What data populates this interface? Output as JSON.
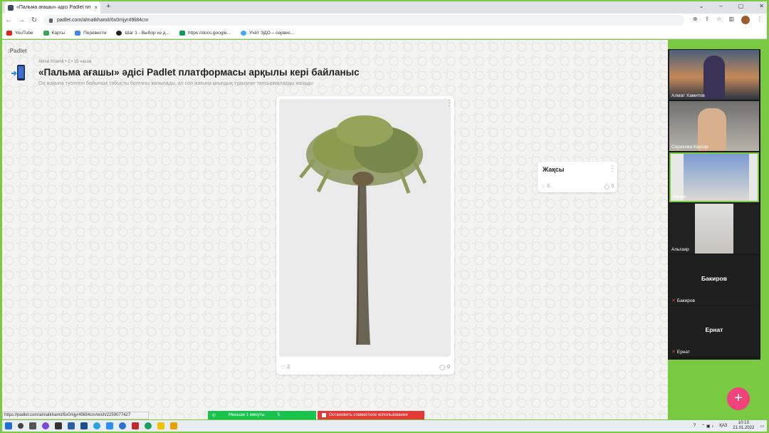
{
  "browser": {
    "tab_title": "«Пальма ағашы» әдісі Padlet пл",
    "tab_close": "×",
    "new_tab": "+",
    "url": "padlet.com/almatkhamit/6x0mjyr49li84cnr",
    "bookmarks": [
      {
        "label": "YouTube",
        "color": "#e62117"
      },
      {
        "label": "Карты",
        "color": "#34a853"
      },
      {
        "label": "Перевести",
        "color": "#4285f4"
      },
      {
        "label": "Шаг 1 - Выбор из д...",
        "color": "#222222"
      },
      {
        "label": "https://docs.google...",
        "color": "#0f9d58"
      },
      {
        "label": "Учёт ЭДО – сервис...",
        "color": "#3fa9f5"
      }
    ],
    "status_url": "https://padlet.com/almatkhamit/6x0mjyr49li84cnr/wish/2259077427"
  },
  "padlet": {
    "logo": ":Padlet",
    "author_line": "Almat Khamit • 1 • 15 часов",
    "title": "«Пальма ағашы» әдісі Padlet платформасы арқылы кері байланыс",
    "description": "Оң жақына түсінгені бойынша табысты болғаны жазылады, ал сол жағына қиындық тудырған тапсырмаларды жазады",
    "posts": [
      {
        "type": "image",
        "image_icon": "palm-tree",
        "likes": "2",
        "comments": "0"
      },
      {
        "type": "text",
        "text": "Жақсы",
        "likes": "0",
        "comments": "0"
      }
    ],
    "fab": "+"
  },
  "meeting": {
    "share_time": "Меньше 1 минуты",
    "share_count": "5",
    "stop_sharing": "Остановить совместное использование",
    "participants": [
      {
        "name": "Алмат Хамитов",
        "video": true,
        "muted": false
      },
      {
        "name": "Серикова Каусар",
        "video": true,
        "muted": false
      },
      {
        "name": "Әміре",
        "video": true,
        "muted": false
      },
      {
        "name": "Альтаир",
        "video": true,
        "muted": false
      },
      {
        "name": "Бакиров",
        "big_name": "Бакиров",
        "video": false,
        "muted": true
      },
      {
        "name": "Ернат",
        "big_name": "Ернат",
        "video": false,
        "muted": true
      }
    ]
  },
  "taskbar": {
    "lang": "ҚАЗ",
    "time": "10:13",
    "date": "21.01.2022"
  },
  "colors": {
    "accent_green": "#7ac943",
    "fab_pink": "#f0437a",
    "share_green": "#18c34d",
    "stop_red": "#e53935"
  }
}
